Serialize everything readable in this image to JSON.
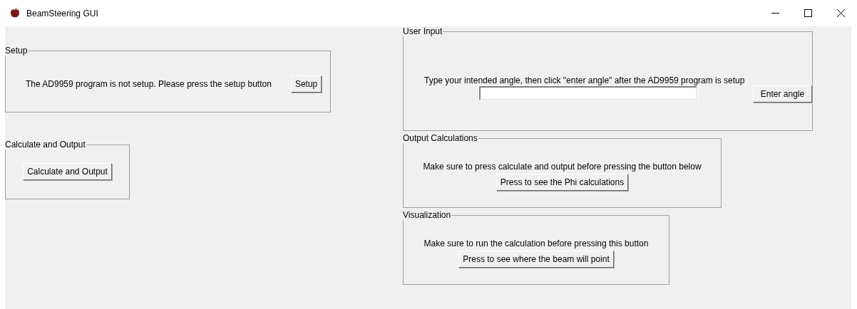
{
  "window": {
    "title": "BeamSteering GUI"
  },
  "setup": {
    "title": "Setup",
    "message": "The AD9959 program is not setup. Please press the setup button",
    "button": "Setup"
  },
  "calculate": {
    "title": "Calculate and Output",
    "button": "Calculate and Output"
  },
  "user_input": {
    "title": "User Input",
    "instruction": "Type your intended angle, then click \"enter angle\" after the AD9959 program is setup",
    "button": "Enter angle"
  },
  "output_calculations": {
    "title": "Output Calculations",
    "message": "Make sure to press calculate and output before pressing the button below",
    "button": "Press to see the Phi calculations"
  },
  "visualization": {
    "title": "Visualization",
    "message": "Make sure to run the calculation before pressing this button",
    "button": "Press to see where the beam will point"
  }
}
